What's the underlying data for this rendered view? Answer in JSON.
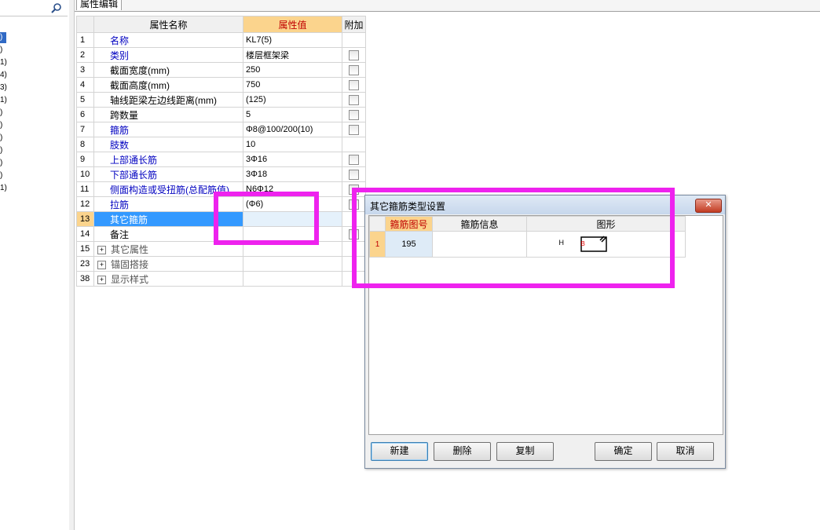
{
  "left": {
    "rows": [
      ")",
      ")",
      "1)",
      "4)",
      "3)",
      "1)",
      ")",
      ")",
      ")",
      ")",
      ")",
      ")",
      "1)"
    ]
  },
  "tab": {
    "title": "属性编辑"
  },
  "grid": {
    "headers": {
      "name": "属性名称",
      "value": "属性值",
      "extra": "附加"
    },
    "rows": [
      {
        "num": "1",
        "name": "名称",
        "value": "KL7(5)"
      },
      {
        "num": "2",
        "name": "类别",
        "value": "楼层框架梁"
      },
      {
        "num": "3",
        "name": "截面宽度(mm)",
        "value": "250"
      },
      {
        "num": "4",
        "name": "截面高度(mm)",
        "value": "750"
      },
      {
        "num": "5",
        "name": "轴线距梁左边线距离(mm)",
        "value": "(125)"
      },
      {
        "num": "6",
        "name": "跨数量",
        "value": "5"
      },
      {
        "num": "7",
        "name": "箍筋",
        "value": "Φ8@100/200(10)"
      },
      {
        "num": "8",
        "name": "肢数",
        "value": "10"
      },
      {
        "num": "9",
        "name": "上部通长筋",
        "value": "3Φ16"
      },
      {
        "num": "10",
        "name": "下部通长筋",
        "value": "3Φ18"
      },
      {
        "num": "11",
        "name": "侧面构造或受扭筋(总配筋值)",
        "value": "N6Φ12"
      },
      {
        "num": "12",
        "name": "拉筋",
        "value": "(Φ6)"
      },
      {
        "num": "13",
        "name": "其它箍筋",
        "value": ""
      },
      {
        "num": "14",
        "name": "备注",
        "value": ""
      },
      {
        "num": "15",
        "name": "其它属性",
        "value": ""
      },
      {
        "num": "23",
        "name": "锚固搭接",
        "value": ""
      },
      {
        "num": "38",
        "name": "显示样式",
        "value": ""
      }
    ]
  },
  "dialog": {
    "title": "其它箍筋类型设置",
    "close_label": "✕",
    "headers": {
      "code": "箍筋图号",
      "info": "箍筋信息",
      "shape": "图形"
    },
    "rows": [
      {
        "num": "1",
        "code": "195",
        "info": "",
        "shape_h": "H",
        "shape_b": "B"
      }
    ],
    "buttons": {
      "new": "新建",
      "delete": "删除",
      "copy": "复制",
      "ok": "确定",
      "cancel": "取消"
    }
  },
  "colors": {
    "annotation": "#ee22ee",
    "selected_row": "#3399ff",
    "header_highlight": "#fbd48d",
    "blue_text": "#0000c0"
  }
}
